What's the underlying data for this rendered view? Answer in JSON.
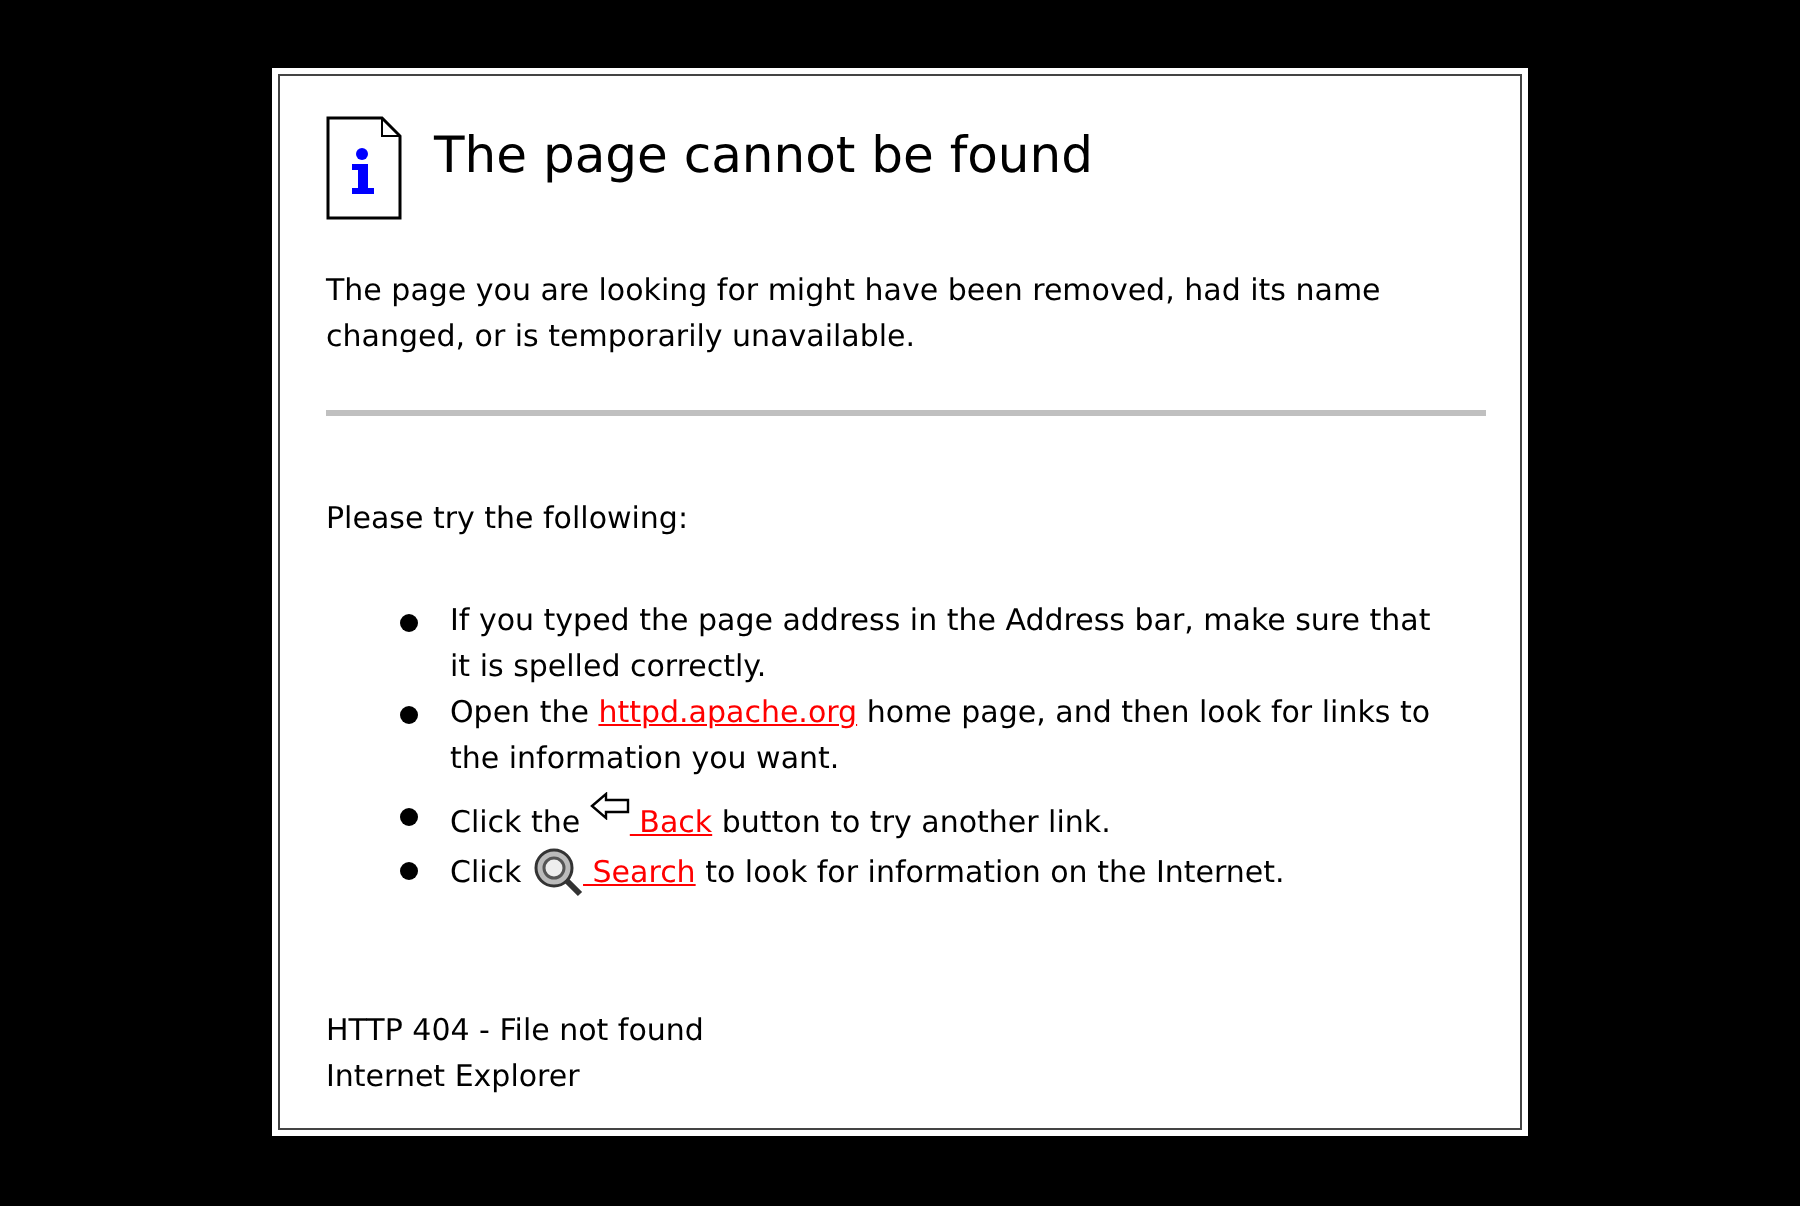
{
  "title": "The page cannot be found",
  "intro": "The page you are looking for might have been removed, had its name changed, or is temporarily unavailable.",
  "prompt": "Please try the following:",
  "suggestions": [
    {
      "kind": "text",
      "before": "If you typed the page address in the Address bar, make sure that it is spelled correctly."
    },
    {
      "kind": "link",
      "before": "Open the ",
      "link": "httpd.apache.org",
      "after": " home page, and then look for links to the information you want."
    },
    {
      "kind": "back",
      "before": "Click the ",
      "link": " Back",
      "after": " button to try another link."
    },
    {
      "kind": "search",
      "before": "Click ",
      "link": " Search",
      "after": " to look for information on the Internet."
    }
  ],
  "footer": [
    "HTTP 404 - File not found",
    "Internet Explorer"
  ]
}
